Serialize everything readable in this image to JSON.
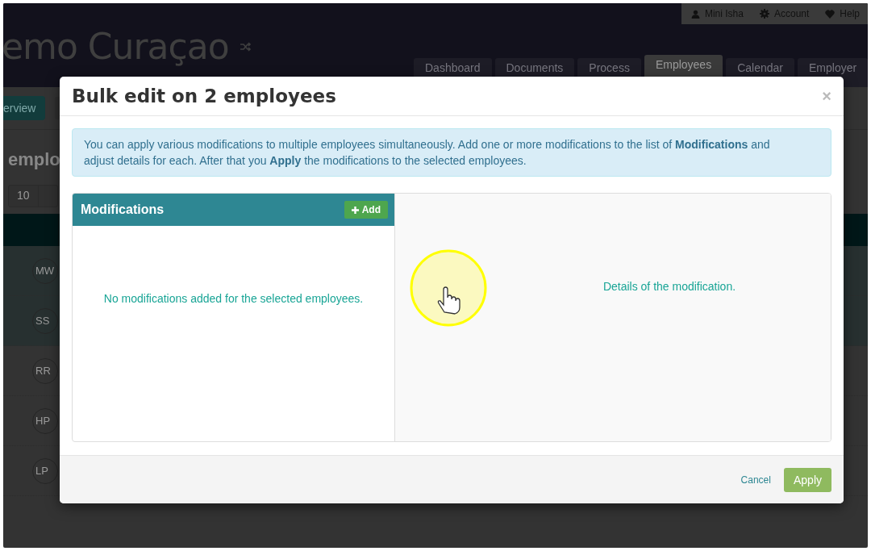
{
  "app": {
    "title": "emo Curaçao",
    "user_menu": [
      {
        "kind": "user",
        "label": "Mini Isha"
      },
      {
        "kind": "account",
        "label": "Account"
      },
      {
        "kind": "help",
        "label": "Help"
      }
    ],
    "tabs": [
      {
        "label": "Dashboard",
        "selected": false
      },
      {
        "label": "Documents",
        "selected": false
      },
      {
        "label": "Process",
        "selected": false
      },
      {
        "label": "Employees",
        "selected": true
      },
      {
        "label": "Calendar",
        "selected": false
      },
      {
        "label": "Employer",
        "selected": false
      }
    ]
  },
  "page": {
    "overview_button": "erview",
    "heading": "emplo",
    "page_size": "10",
    "rows": [
      {
        "initials": "MW",
        "selected": true
      },
      {
        "initials": "SS",
        "selected": true
      },
      {
        "initials": "RR",
        "selected": false
      },
      {
        "initials": "HP",
        "selected": false
      },
      {
        "initials": "LP",
        "selected": false
      }
    ]
  },
  "modal": {
    "title": "Bulk edit on 2 employees",
    "close": "×",
    "info": "You can apply various modifications to multiple employees simultaneously. Add one or more modifications to the list of **Modifications** and adjust details for each. After that you **Apply** the modifications to the selected employees.",
    "list_title": "Modifications",
    "add_button": "Add",
    "empty_text": "No modifications added for the selected employees.",
    "details_text": "Details of the modification.",
    "cancel": "Cancel",
    "apply": "Apply"
  }
}
